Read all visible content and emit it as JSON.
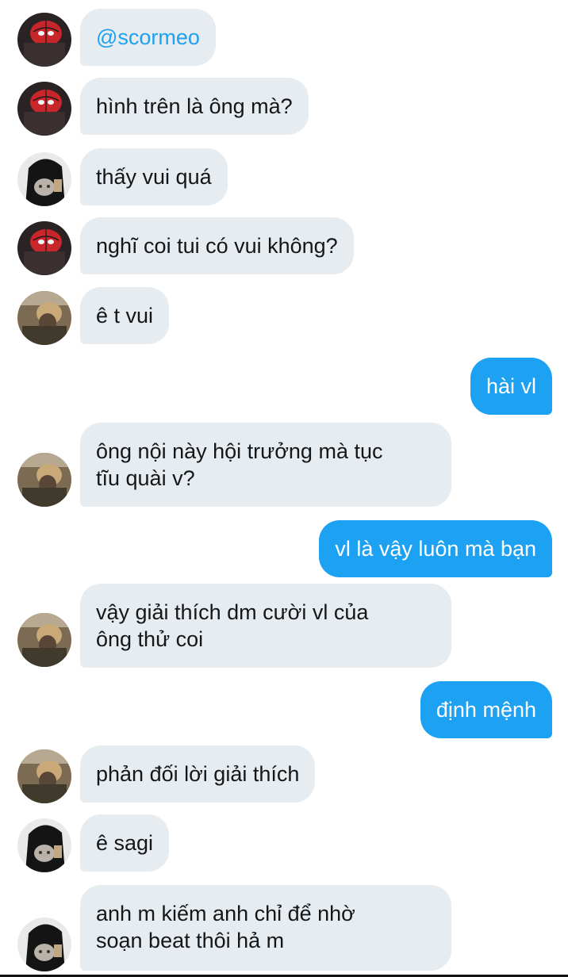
{
  "colors": {
    "incoming_bubble": "#e6ecf0",
    "outgoing_bubble": "#1da1f2",
    "mention": "#1da1f2",
    "text": "#14171a"
  },
  "messages": [
    {
      "direction": "in",
      "avatar": "spiderman-avatar",
      "text": "@scormeo"
    },
    {
      "direction": "in",
      "avatar": "spiderman-avatar",
      "text": "hình trên là ông mà?"
    },
    {
      "direction": "in",
      "avatar": "cat-holder-avatar",
      "text": "thấy vui quá"
    },
    {
      "direction": "in",
      "avatar": "spiderman-avatar",
      "text": "nghĩ coi tui có vui không?"
    },
    {
      "direction": "in",
      "avatar": "blonde-boy-avatar",
      "text": "ê t vui"
    },
    {
      "direction": "out",
      "text": "hài vl"
    },
    {
      "direction": "in",
      "avatar": "blonde-boy-avatar",
      "lines": [
        "ông nội này hội trưởng mà tục",
        "tĩu quài v?"
      ]
    },
    {
      "direction": "out",
      "text": "vl là vậy luôn mà bạn"
    },
    {
      "direction": "in",
      "avatar": "blonde-boy-avatar",
      "lines": [
        "vậy giải thích dm cười vl của",
        "ông thử coi"
      ]
    },
    {
      "direction": "out",
      "text": "định mệnh"
    },
    {
      "direction": "in",
      "avatar": "blonde-boy-avatar",
      "text": "phản đối lời giải thích"
    },
    {
      "direction": "in",
      "avatar": "cat-holder-avatar",
      "text": "ê sagi"
    },
    {
      "direction": "in",
      "avatar": "cat-holder-avatar",
      "lines": [
        "anh m kiếm anh chỉ để nhờ",
        "soạn beat thôi hả m"
      ]
    }
  ]
}
